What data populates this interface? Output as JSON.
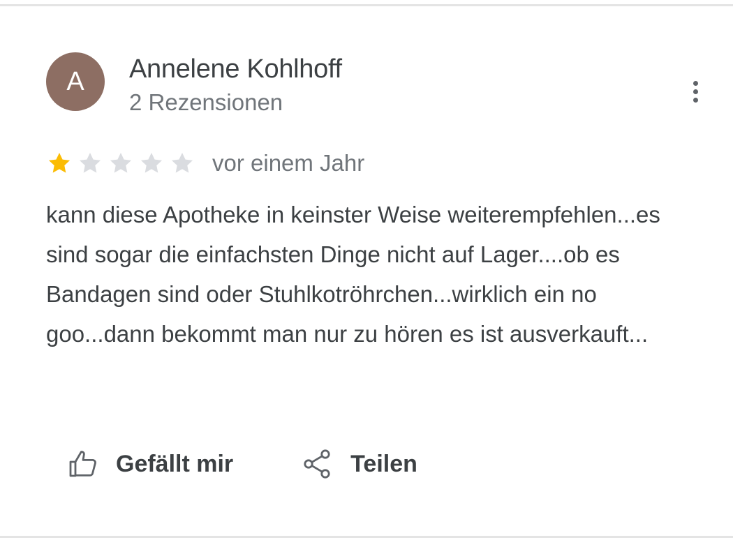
{
  "review": {
    "author": {
      "initial": "A",
      "name": "Annelene Kohlhoff",
      "meta": "2 Rezensionen",
      "avatar_color": "#8d6e63"
    },
    "rating": {
      "value": 1,
      "max": 5,
      "filled_color": "#fbbc04",
      "empty_color": "#dadce0"
    },
    "date": "vor einem Jahr",
    "text": "kann diese Apotheke in keinster Weise weiterempfehlen...es sind sogar die einfachsten Dinge nicht auf Lager....ob es Bandagen sind oder Stuhlkotröhrchen...wirklich ein no goo...dann bekommt man nur zu hören es ist ausverkauft...",
    "menu_icon": "more-vertical-icon"
  },
  "actions": {
    "like": {
      "label": "Gefällt mir",
      "icon": "thumb-up-icon"
    },
    "share": {
      "label": "Teilen",
      "icon": "share-icon"
    }
  }
}
